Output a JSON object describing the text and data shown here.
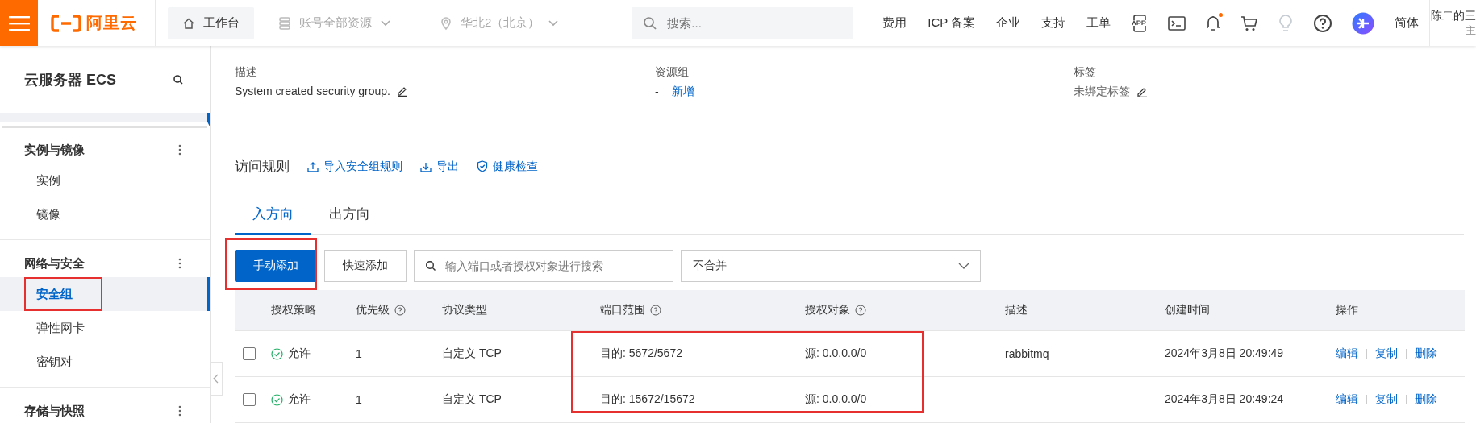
{
  "topbar": {
    "logo": "阿里云",
    "workbench": "工作台",
    "resource_scope": "账号全部资源",
    "region": "华北2（北京）",
    "search": {
      "placeholder": "搜索..."
    },
    "links": [
      "费用",
      "ICP 备案",
      "企业",
      "支持",
      "工单"
    ],
    "notifications_unread": true,
    "language": "简体",
    "user": {
      "name": "陈二的三",
      "role": "主"
    }
  },
  "sidebar": {
    "title": "云服务器 ECS",
    "groups": [
      {
        "title": "实例与镜像",
        "items": [
          {
            "label": "实例",
            "selected": false
          },
          {
            "label": "镜像",
            "selected": false
          }
        ]
      },
      {
        "title": "网络与安全",
        "items": [
          {
            "label": "安全组",
            "selected": true
          },
          {
            "label": "弹性网卡",
            "selected": false
          },
          {
            "label": "密钥对",
            "selected": false
          }
        ]
      },
      {
        "title": "存储与快照"
      }
    ]
  },
  "details": [
    {
      "label": "描述",
      "value": "System created security group.",
      "editable": true
    },
    {
      "label": "资源组",
      "value": "-",
      "link": "新增"
    },
    {
      "label": "标签",
      "value": "未绑定标签",
      "editable": true
    }
  ],
  "rules": {
    "title": "访问规则",
    "actions": [
      {
        "kind": "import",
        "label": "导入安全组规则"
      },
      {
        "kind": "export",
        "label": "导出"
      },
      {
        "kind": "check",
        "label": "健康检查"
      }
    ],
    "tabs": [
      {
        "label": "入方向",
        "selected": true
      },
      {
        "label": "出方向",
        "selected": false
      }
    ],
    "primary_button": "手动添加",
    "secondary_button": "快速添加",
    "search": {
      "placeholder": "输入端口或者授权对象进行搜索"
    },
    "merge_select": "不合并",
    "table": {
      "columns": [
        {
          "label": "授权策略"
        },
        {
          "label": "优先级",
          "help": true
        },
        {
          "label": "协议类型"
        },
        {
          "label": "端口范围",
          "help": true
        },
        {
          "label": "授权对象",
          "help": true
        },
        {
          "label": "描述"
        },
        {
          "label": "创建时间"
        },
        {
          "label": "操作"
        }
      ],
      "rows": [
        {
          "checked": false,
          "policy": "允许",
          "priority": "1",
          "protocol": "自定义 TCP",
          "port": "目的: 5672/5672",
          "source": "源: 0.0.0.0/0",
          "description": "rabbitmq",
          "created": "2024年3月8日 20:49:49",
          "actions": [
            "编辑",
            "复制",
            "删除"
          ]
        },
        {
          "checked": false,
          "policy": "允许",
          "priority": "1",
          "protocol": "自定义 TCP",
          "port": "目的: 15672/15672",
          "source": "源: 0.0.0.0/0",
          "created": "2024年3月8日 20:49:24",
          "actions": [
            "编辑",
            "复制",
            "删除"
          ]
        }
      ]
    }
  }
}
